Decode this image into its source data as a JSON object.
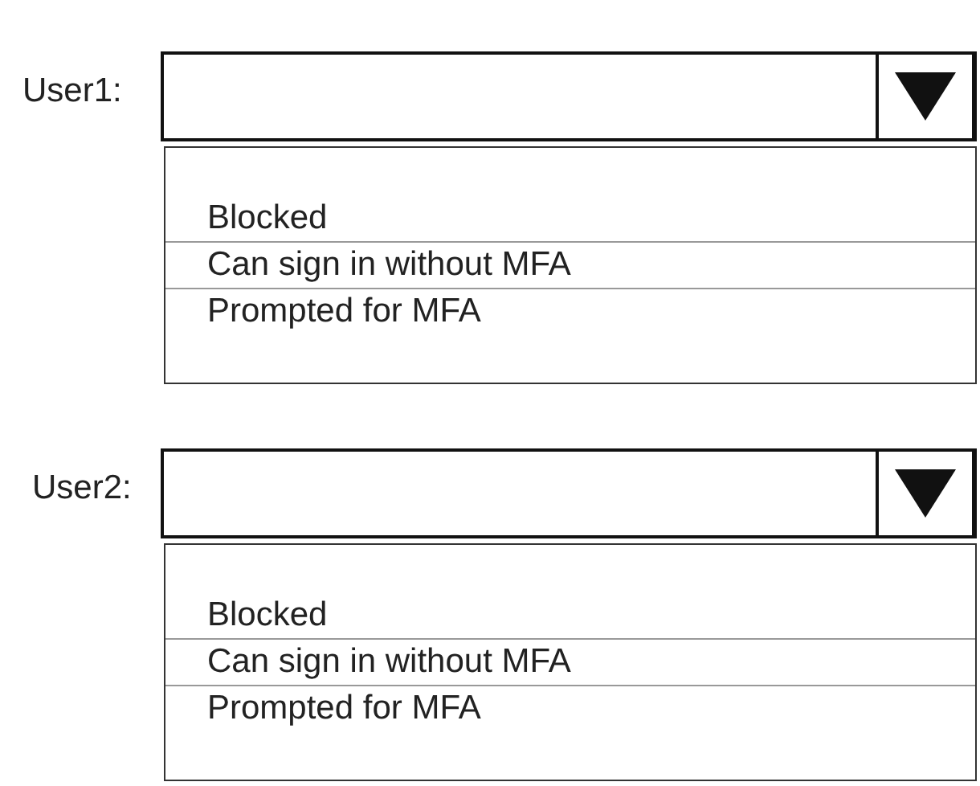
{
  "dropdowns": [
    {
      "label": "User1:",
      "options": [
        "Blocked",
        "Can sign in without MFA",
        "Prompted for MFA"
      ]
    },
    {
      "label": "User2:",
      "options": [
        "Blocked",
        "Can sign in without MFA",
        "Prompted for MFA"
      ]
    }
  ]
}
